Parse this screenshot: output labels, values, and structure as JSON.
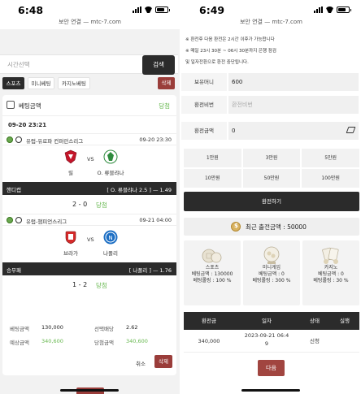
{
  "left": {
    "status_time": "6:48",
    "url": "보안 연결 — mtc-7.com",
    "date_placeholder": "시간선택",
    "search_label": "검색",
    "filters": [
      "스포츠",
      "미니베팅",
      "카지노베팅"
    ],
    "delete_label": "삭제",
    "card": {
      "title": "베팅금액",
      "result": "당첨",
      "date": "09-20 23:21",
      "games": [
        {
          "league": "유럽-유로파 컨퍼런스리그",
          "time": "09-20 23:30",
          "home": "릴",
          "vs": "VS",
          "away": "O. 류블랴나",
          "bet_type": "핸디캡",
          "pick": "[ O. 류블랴나 2.5 ] — 1.49",
          "score": "2 - 0",
          "result": "당첨"
        },
        {
          "league": "유럽-챔피언스리그",
          "time": "09-21 04:00",
          "home": "브라가",
          "vs": "VS",
          "away": "나폴리",
          "bet_type": "승무패",
          "pick": "[ 나폴리 ] — 1.76",
          "score": "1 - 2",
          "result": "당첨"
        }
      ],
      "summary": {
        "bet_amount_label": "베팅금액",
        "bet_amount": "130,000",
        "odds_label": "선택배당",
        "odds": "2.62",
        "expected_label": "예상금액",
        "expected": "340,600",
        "win_label": "당첨금액",
        "win_amount": "340,600"
      },
      "cancel_label": "취소",
      "delete_label": "삭제"
    }
  },
  "right": {
    "status_time": "6:49",
    "url": "보안 연결 — mtc-7.com",
    "notices": [
      "※ 환전후 다음 환전은 2시간 이후가 가능합니다",
      "※ 매일 23시 30분 ~ 06시 30분까지 은행 점검",
      "및 일자전환으로 환전 중단됩니다."
    ],
    "form": {
      "holding_label": "보유머니",
      "holding_value": "600",
      "password_label": "환전비번",
      "password_placeholder": "환전비번",
      "amount_label": "환전금액",
      "amount_value": "0"
    },
    "quick_amounts": [
      "1만원",
      "3만원",
      "5만원",
      "10만원",
      "50만원",
      "100만원"
    ],
    "exchange_button": "환전하기",
    "recent_exchange": "최근 출전금액 : 50000",
    "rates": [
      {
        "name": "스포츠",
        "line1": "베팅금액 : 130000",
        "line2": "베팅롤링 : 100 %"
      },
      {
        "name": "미니게임",
        "line1": "베팅금액 : 0",
        "line2": "베팅롤링 : 300 %"
      },
      {
        "name": "카지노",
        "line1": "베팅금액 : 0",
        "line2": "베팅롤링 : 30 %"
      }
    ],
    "table": {
      "headers": [
        "환전금",
        "일자",
        "상태",
        "실행"
      ],
      "rows": [
        {
          "amount": "340,000",
          "date_a": "2023-09-21 06:4",
          "date_b": "9",
          "status": "신청",
          "action": ""
        }
      ]
    },
    "next_button": "다음"
  },
  "colors": {
    "accent_red": "#9a3d3a",
    "dark": "#2b2b2b",
    "win_green": "#67b84f"
  }
}
